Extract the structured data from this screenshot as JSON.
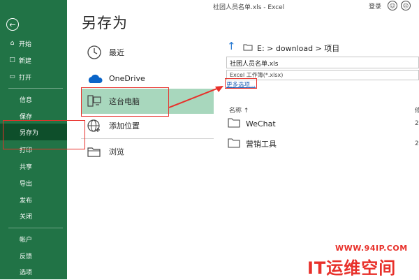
{
  "window": {
    "title": "社团人员名单.xls  -  Excel",
    "signin_label": "登录",
    "smile_icon": "smile-icon",
    "frown_icon": "frown-icon"
  },
  "sidebar": {
    "back_icon": "back-arrow-icon",
    "items": [
      {
        "label": "开始",
        "icon": "home-icon"
      },
      {
        "label": "新建",
        "icon": "new-doc-icon"
      },
      {
        "label": "打开",
        "icon": "open-folder-icon"
      },
      {
        "label": "信息"
      },
      {
        "label": "保存"
      },
      {
        "label": "另存为",
        "active": true
      },
      {
        "label": "打印"
      },
      {
        "label": "共享"
      },
      {
        "label": "导出"
      },
      {
        "label": "发布"
      },
      {
        "label": "关闭"
      },
      {
        "label": "帐户"
      },
      {
        "label": "反馈"
      },
      {
        "label": "选项"
      }
    ]
  },
  "middle": {
    "title": "另存为",
    "locations": [
      {
        "label": "最近",
        "icon": "clock-icon"
      },
      {
        "label": "OneDrive",
        "icon": "cloud-icon"
      },
      {
        "label": "这台电脑",
        "icon": "computer-icon",
        "selected": true
      },
      {
        "label": "添加位置",
        "icon": "globe-icon"
      },
      {
        "label": "浏览",
        "icon": "folder-icon"
      }
    ]
  },
  "right": {
    "path": "E: > download > 项目",
    "filename": "社团人员名单.xls",
    "filetype": "Excel 工作簿(*.xlsx)",
    "more_options": "更多选项...",
    "column_name": "名称 ↑",
    "column_date": "修",
    "folders": [
      {
        "name": "WeChat",
        "date": "2"
      },
      {
        "name": "营销工具",
        "date": "2"
      }
    ]
  },
  "colors": {
    "sidebar": "#217346",
    "sidebar_active": "#0e4f2b",
    "selected_location": "#a8d7bd",
    "annotation": "#e8302a",
    "link": "#1f5fb6"
  },
  "watermark": {
    "url": "WWW.94IP.COM",
    "brand": "IT运维空间"
  }
}
